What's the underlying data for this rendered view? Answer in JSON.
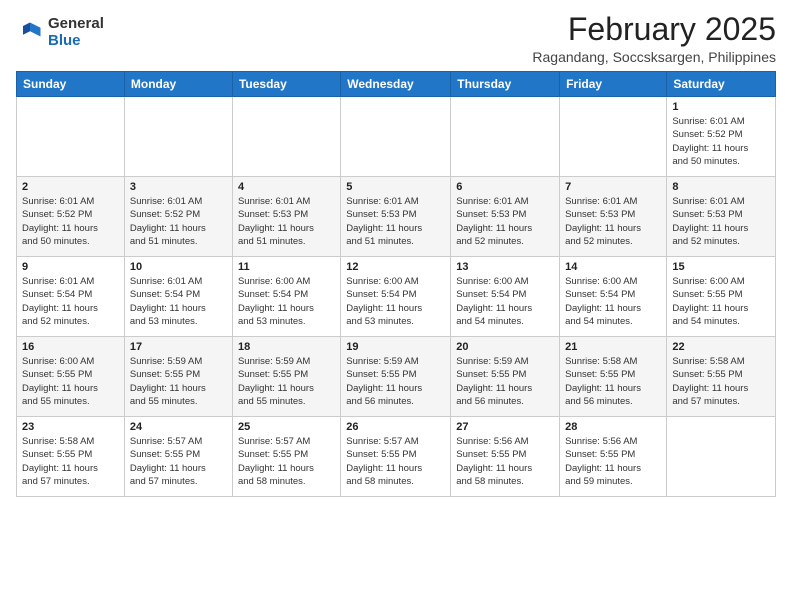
{
  "header": {
    "logo_general": "General",
    "logo_blue": "Blue",
    "month_title": "February 2025",
    "location": "Ragandang, Soccsksargen, Philippines"
  },
  "weekdays": [
    "Sunday",
    "Monday",
    "Tuesday",
    "Wednesday",
    "Thursday",
    "Friday",
    "Saturday"
  ],
  "weeks": [
    [
      {
        "day": "",
        "info": ""
      },
      {
        "day": "",
        "info": ""
      },
      {
        "day": "",
        "info": ""
      },
      {
        "day": "",
        "info": ""
      },
      {
        "day": "",
        "info": ""
      },
      {
        "day": "",
        "info": ""
      },
      {
        "day": "1",
        "info": "Sunrise: 6:01 AM\nSunset: 5:52 PM\nDaylight: 11 hours\nand 50 minutes."
      }
    ],
    [
      {
        "day": "2",
        "info": "Sunrise: 6:01 AM\nSunset: 5:52 PM\nDaylight: 11 hours\nand 50 minutes."
      },
      {
        "day": "3",
        "info": "Sunrise: 6:01 AM\nSunset: 5:52 PM\nDaylight: 11 hours\nand 51 minutes."
      },
      {
        "day": "4",
        "info": "Sunrise: 6:01 AM\nSunset: 5:53 PM\nDaylight: 11 hours\nand 51 minutes."
      },
      {
        "day": "5",
        "info": "Sunrise: 6:01 AM\nSunset: 5:53 PM\nDaylight: 11 hours\nand 51 minutes."
      },
      {
        "day": "6",
        "info": "Sunrise: 6:01 AM\nSunset: 5:53 PM\nDaylight: 11 hours\nand 52 minutes."
      },
      {
        "day": "7",
        "info": "Sunrise: 6:01 AM\nSunset: 5:53 PM\nDaylight: 11 hours\nand 52 minutes."
      },
      {
        "day": "8",
        "info": "Sunrise: 6:01 AM\nSunset: 5:53 PM\nDaylight: 11 hours\nand 52 minutes."
      }
    ],
    [
      {
        "day": "9",
        "info": "Sunrise: 6:01 AM\nSunset: 5:54 PM\nDaylight: 11 hours\nand 52 minutes."
      },
      {
        "day": "10",
        "info": "Sunrise: 6:01 AM\nSunset: 5:54 PM\nDaylight: 11 hours\nand 53 minutes."
      },
      {
        "day": "11",
        "info": "Sunrise: 6:00 AM\nSunset: 5:54 PM\nDaylight: 11 hours\nand 53 minutes."
      },
      {
        "day": "12",
        "info": "Sunrise: 6:00 AM\nSunset: 5:54 PM\nDaylight: 11 hours\nand 53 minutes."
      },
      {
        "day": "13",
        "info": "Sunrise: 6:00 AM\nSunset: 5:54 PM\nDaylight: 11 hours\nand 54 minutes."
      },
      {
        "day": "14",
        "info": "Sunrise: 6:00 AM\nSunset: 5:54 PM\nDaylight: 11 hours\nand 54 minutes."
      },
      {
        "day": "15",
        "info": "Sunrise: 6:00 AM\nSunset: 5:55 PM\nDaylight: 11 hours\nand 54 minutes."
      }
    ],
    [
      {
        "day": "16",
        "info": "Sunrise: 6:00 AM\nSunset: 5:55 PM\nDaylight: 11 hours\nand 55 minutes."
      },
      {
        "day": "17",
        "info": "Sunrise: 5:59 AM\nSunset: 5:55 PM\nDaylight: 11 hours\nand 55 minutes."
      },
      {
        "day": "18",
        "info": "Sunrise: 5:59 AM\nSunset: 5:55 PM\nDaylight: 11 hours\nand 55 minutes."
      },
      {
        "day": "19",
        "info": "Sunrise: 5:59 AM\nSunset: 5:55 PM\nDaylight: 11 hours\nand 56 minutes."
      },
      {
        "day": "20",
        "info": "Sunrise: 5:59 AM\nSunset: 5:55 PM\nDaylight: 11 hours\nand 56 minutes."
      },
      {
        "day": "21",
        "info": "Sunrise: 5:58 AM\nSunset: 5:55 PM\nDaylight: 11 hours\nand 56 minutes."
      },
      {
        "day": "22",
        "info": "Sunrise: 5:58 AM\nSunset: 5:55 PM\nDaylight: 11 hours\nand 57 minutes."
      }
    ],
    [
      {
        "day": "23",
        "info": "Sunrise: 5:58 AM\nSunset: 5:55 PM\nDaylight: 11 hours\nand 57 minutes."
      },
      {
        "day": "24",
        "info": "Sunrise: 5:57 AM\nSunset: 5:55 PM\nDaylight: 11 hours\nand 57 minutes."
      },
      {
        "day": "25",
        "info": "Sunrise: 5:57 AM\nSunset: 5:55 PM\nDaylight: 11 hours\nand 58 minutes."
      },
      {
        "day": "26",
        "info": "Sunrise: 5:57 AM\nSunset: 5:55 PM\nDaylight: 11 hours\nand 58 minutes."
      },
      {
        "day": "27",
        "info": "Sunrise: 5:56 AM\nSunset: 5:55 PM\nDaylight: 11 hours\nand 58 minutes."
      },
      {
        "day": "28",
        "info": "Sunrise: 5:56 AM\nSunset: 5:55 PM\nDaylight: 11 hours\nand 59 minutes."
      },
      {
        "day": "",
        "info": ""
      }
    ]
  ]
}
